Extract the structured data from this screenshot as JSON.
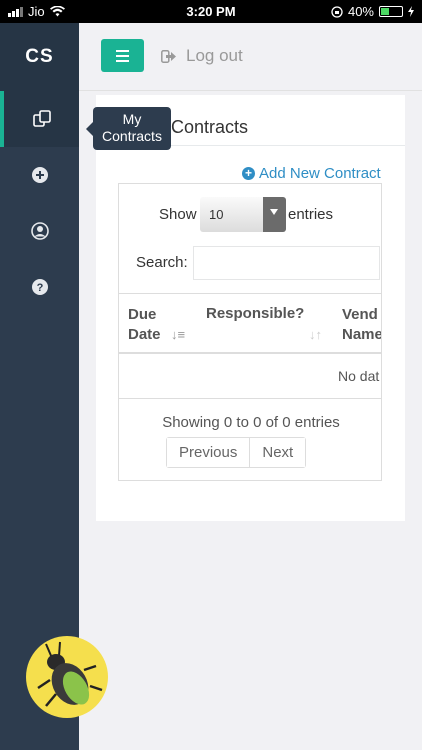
{
  "status_bar": {
    "carrier": "Jio",
    "time": "3:20 PM",
    "battery": "40%"
  },
  "sidebar": {
    "brand": "CS",
    "items": [
      {
        "icon": "contracts-icon",
        "active": true
      },
      {
        "icon": "add-circle-icon",
        "active": false
      },
      {
        "icon": "user-circle-icon",
        "active": false
      },
      {
        "icon": "help-icon",
        "active": false
      }
    ],
    "tooltip": "My Contracts"
  },
  "topbar": {
    "menu_icon": "hamburger-icon",
    "logout_label": "Log out"
  },
  "main": {
    "card_title": "My Contracts",
    "add_link": "Add New Contract",
    "length_prefix": "Show",
    "length_value": "10",
    "length_suffix": "entries",
    "search_label": "Search:",
    "search_value": "",
    "columns": [
      {
        "line1": "Due",
        "line2": "Date"
      },
      {
        "line1": "Responsible?"
      },
      {
        "line1": "Vend",
        "line2": "Name"
      }
    ],
    "no_data": "No dat",
    "info": "Showing 0 to 0 of 0 entries",
    "prev": "Previous",
    "next": "Next"
  },
  "colors": {
    "accent": "#1ab394",
    "sidebar": "#2d3c4e",
    "link": "#2f8ec5"
  }
}
